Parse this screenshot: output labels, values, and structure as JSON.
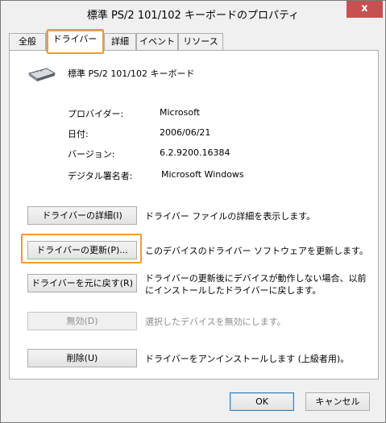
{
  "window": {
    "title": "標準 PS/2 101/102 キーボードのプロパティ",
    "close_symbol": "x"
  },
  "tabs": [
    {
      "label": "全般"
    },
    {
      "label": "ドライバー"
    },
    {
      "label": "詳細"
    },
    {
      "label": "イベント"
    },
    {
      "label": "リソース"
    }
  ],
  "device": {
    "name": "標準 PS/2 101/102 キーボード",
    "icon": "keyboard-icon"
  },
  "properties": [
    {
      "label": "プロバイダー:",
      "value": "Microsoft"
    },
    {
      "label": "日付:",
      "value": "2006/06/21"
    },
    {
      "label": "バージョン:",
      "value": "6.2.9200.16384"
    },
    {
      "label": "デジタル署名者:",
      "value": "Microsoft Windows"
    }
  ],
  "actions": [
    {
      "button": "ドライバーの詳細(I)",
      "description": "ドライバー ファイルの詳細を表示します。"
    },
    {
      "button": "ドライバーの更新(P)...",
      "description": "このデバイスのドライバー ソフトウェアを更新します。"
    },
    {
      "button": "ドライバーを元に戻す(R)",
      "description": "ドライバーの更新後にデバイスが動作しない場合、以前にインストールしたドライバーに戻します。"
    },
    {
      "button": "無効(D)",
      "description": "選択したデバイスを無効にします。"
    },
    {
      "button": "削除(U)",
      "description": "ドライバーをアンインストールします (上級者用)。"
    }
  ],
  "footer": {
    "ok_label": "OK",
    "cancel_label": "キャンセル"
  },
  "colors": {
    "highlight": "#f39c26",
    "close_button": "#c75050"
  }
}
